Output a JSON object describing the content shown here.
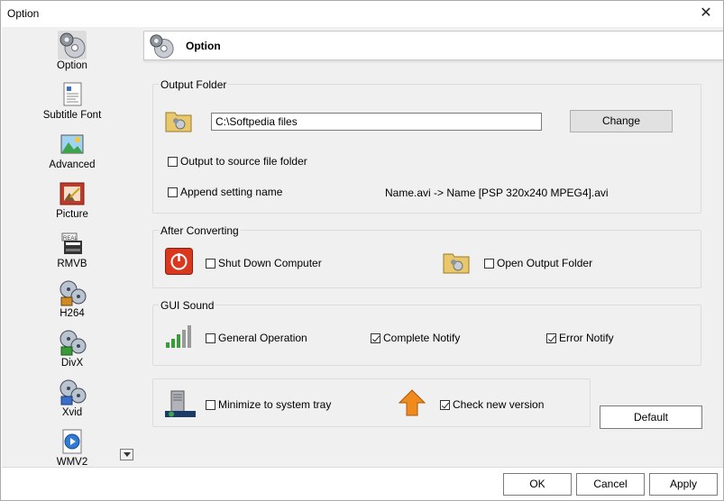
{
  "window": {
    "title": "Option",
    "close_glyph": "✕"
  },
  "sidebar": {
    "items": [
      {
        "label": "Option",
        "icon": "gear-disc-icon",
        "selected": true
      },
      {
        "label": "Subtitle Font",
        "icon": "subtitle-document-icon"
      },
      {
        "label": "Advanced",
        "icon": "landscape-image-icon"
      },
      {
        "label": "Picture",
        "icon": "picture-frame-icon"
      },
      {
        "label": "RMVB",
        "icon": "real-media-icon"
      },
      {
        "label": "H264",
        "icon": "film-reel-icon"
      },
      {
        "label": "DivX",
        "icon": "film-reel-icon"
      },
      {
        "label": "Xvid",
        "icon": "film-reel-icon"
      },
      {
        "label": "WMV2",
        "icon": "windows-media-icon"
      }
    ]
  },
  "header": {
    "title": "Option"
  },
  "output_folder": {
    "title": "Output Folder",
    "path": "C:\\Softpedia files",
    "change_label": "Change",
    "to_source_label": "Output to source file folder",
    "to_source_checked": false,
    "append_label": "Append setting name",
    "append_checked": false,
    "sample_text": "Name.avi  -> Name [PSP 320x240 MPEG4].avi"
  },
  "after_converting": {
    "title": "After Converting",
    "shutdown_label": "Shut Down Computer",
    "shutdown_checked": false,
    "open_folder_label": "Open Output Folder",
    "open_folder_checked": false
  },
  "gui_sound": {
    "title": "GUI Sound",
    "general_label": "General Operation",
    "general_checked": false,
    "complete_label": "Complete Notify",
    "complete_checked": true,
    "error_label": "Error Notify",
    "error_checked": true
  },
  "misc": {
    "minimize_label": "Minimize to system tray",
    "minimize_checked": false,
    "check_version_label": "Check new version",
    "check_version_checked": true
  },
  "buttons": {
    "default": "Default",
    "ok": "OK",
    "cancel": "Cancel",
    "apply": "Apply"
  },
  "colors": {
    "accent_red": "#d9381e",
    "folder_yellow": "#e8c86a",
    "window_bg": "#f0f0f0"
  }
}
